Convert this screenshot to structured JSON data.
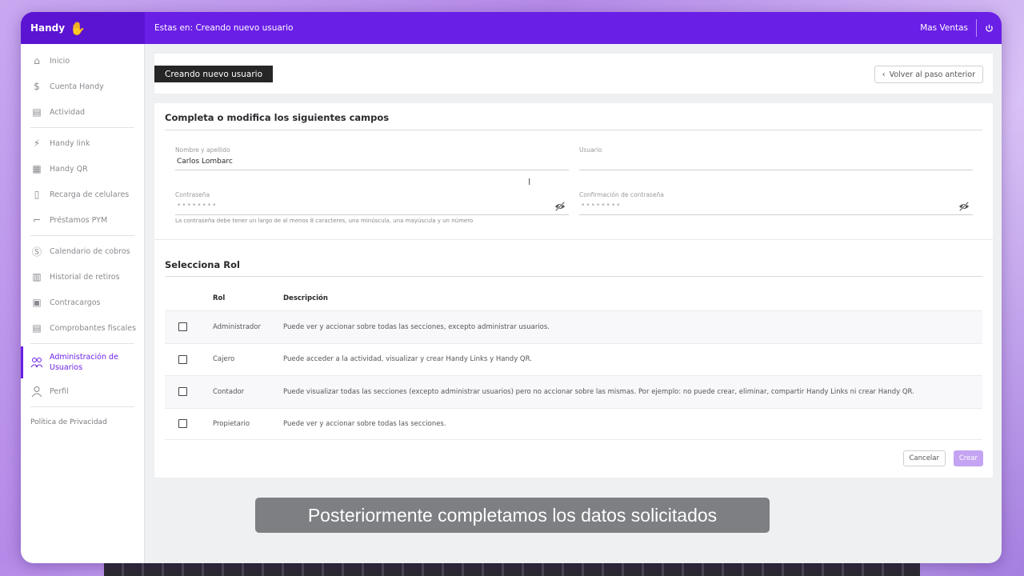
{
  "topbar": {
    "brand": "Handy",
    "breadcrumb": "Estas en: Creando nuevo usuario",
    "user_name": "Mas Ventas"
  },
  "sidebar": {
    "items": [
      {
        "label": "Inicio",
        "icon": "home-icon"
      },
      {
        "label": "Cuenta Handy",
        "icon": "money-hand-icon"
      },
      {
        "label": "Actividad",
        "icon": "activity-icon"
      },
      {
        "label": "Handy link",
        "icon": "link-icon"
      },
      {
        "label": "Handy QR",
        "icon": "qr-icon"
      },
      {
        "label": "Recarga de celulares",
        "icon": "phone-icon"
      },
      {
        "label": "Préstamos PYM",
        "icon": "loan-icon"
      },
      {
        "label": "Calendario de cobros",
        "icon": "dollar-circle-icon"
      },
      {
        "label": "Historial de retiros",
        "icon": "history-icon"
      },
      {
        "label": "Contracargos",
        "icon": "receipt-icon"
      },
      {
        "label": "Comprobantes fiscales",
        "icon": "invoice-icon"
      },
      {
        "label": "Administración de Usuarios",
        "icon": "users-icon"
      },
      {
        "label": "Perfil",
        "icon": "user-icon"
      }
    ],
    "privacy": "Política de Privacidad"
  },
  "header": {
    "title": "Creando nuevo usuario",
    "back_label": "Volver al paso anterior"
  },
  "form": {
    "section_title": "Completa o modifica los siguientes campos",
    "name_label": "Nombre y apellido",
    "name_value": "Carlos Lombarc",
    "user_label": "Usuario",
    "user_value": "",
    "password_label": "Contraseña",
    "password_mask": "••••••••",
    "confirm_label": "Confirmación de contraseña",
    "confirm_mask": "••••••••",
    "password_hint": "La contraseña debe tener un largo de al menos 8 caracteres, una minúscula, una mayúscula y un número"
  },
  "roles": {
    "section_title": "Selecciona Rol",
    "col_rol": "Rol",
    "col_desc": "Descripción",
    "rows": [
      {
        "rol": "Administrador",
        "desc": "Puede ver y accionar sobre todas las secciones, excepto administrar usuarios."
      },
      {
        "rol": "Cajero",
        "desc": "Puede acceder a la actividad, visualizar y crear Handy Links y Handy QR."
      },
      {
        "rol": "Contador",
        "desc": "Puede visualizar todas las secciones (excepto administrar usuarios) pero no accionar sobre las mismas. Por ejemplo: no puede crear, eliminar, compartir Handy Links ni crear Handy QR."
      },
      {
        "rol": "Propietario",
        "desc": "Puede ver y accionar sobre todas las secciones."
      }
    ]
  },
  "actions": {
    "cancel_label": "Cancelar",
    "create_label": "Crear"
  },
  "caption": "Posteriormente completamos los datos solicitados",
  "colors": {
    "brand": "#6a1fe6",
    "create_disabled": "#c4a3f3"
  }
}
